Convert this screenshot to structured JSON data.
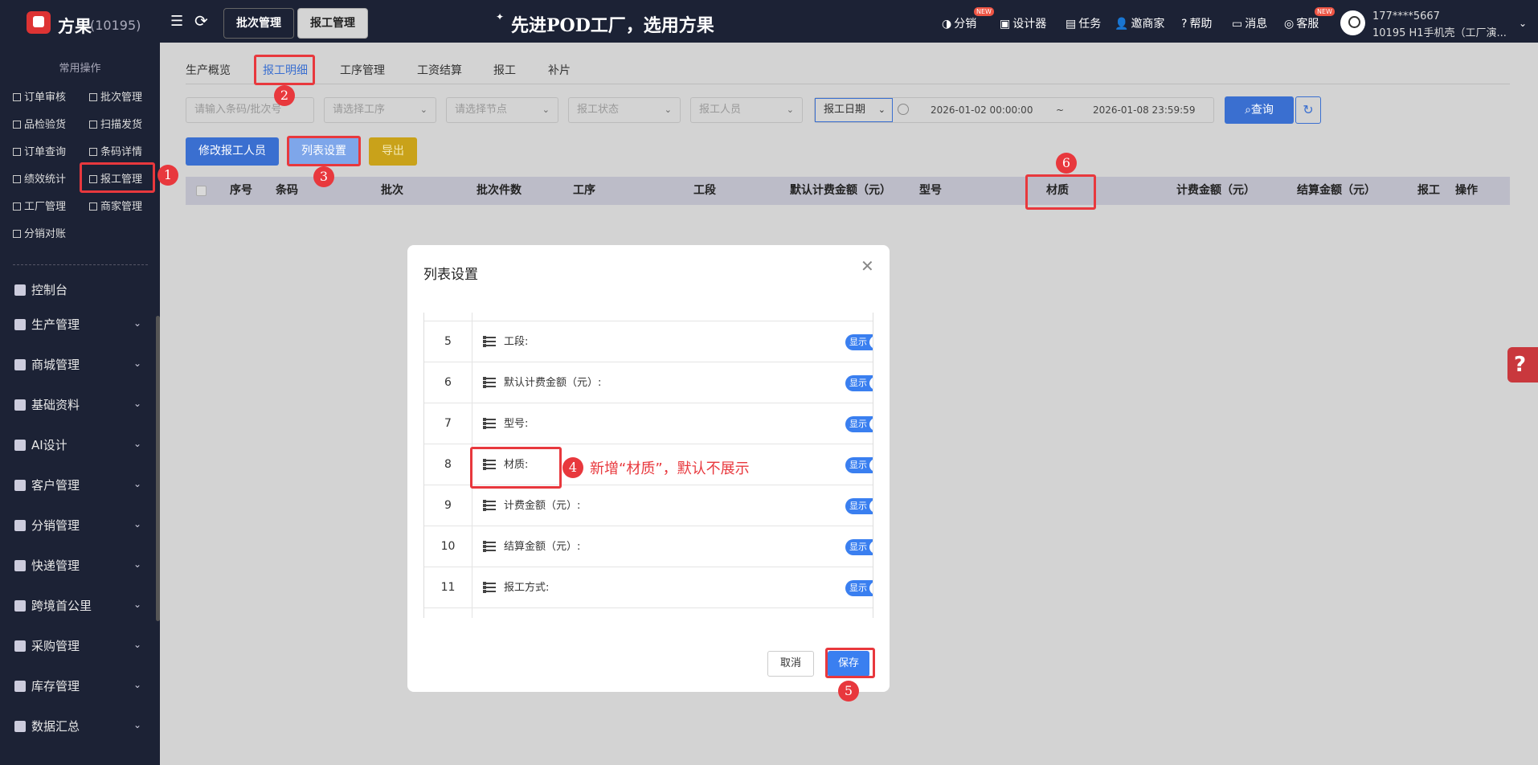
{
  "header": {
    "brand": "方果",
    "brand_id": "(10195)",
    "top_tabs": [
      "批次管理",
      "报工管理"
    ],
    "slogan": "先进POD工厂，选用方果",
    "actions": [
      {
        "label": "分销",
        "badge": "NEW"
      },
      {
        "label": "设计器"
      },
      {
        "label": "任务"
      },
      {
        "label": "邀商家"
      },
      {
        "label": "帮助"
      },
      {
        "label": "消息"
      },
      {
        "label": "客服",
        "badge": "NEW"
      }
    ],
    "user_phone": "177****5667",
    "user_org": "10195  H1手机壳（工厂演..."
  },
  "sidebar": {
    "section_title": "常用操作",
    "quick_links": [
      "订单审核",
      "批次管理",
      "品检验货",
      "扫描发货",
      "订单查询",
      "条码详情",
      "绩效统计",
      "报工管理",
      "工厂管理",
      "商家管理",
      "分销对账"
    ],
    "nav_items": [
      "控制台",
      "生产管理",
      "商城管理",
      "基础资料",
      "AI设计",
      "客户管理",
      "分销管理",
      "快递管理",
      "跨境首公里",
      "采购管理",
      "库存管理",
      "数据汇总"
    ]
  },
  "main": {
    "subtabs": [
      "生产概览",
      "报工明细",
      "工序管理",
      "工资结算",
      "报工",
      "补片"
    ],
    "filters": {
      "barcode_placeholder": "请输入条码/批次号",
      "process_placeholder": "请选择工序",
      "node_placeholder": "请选择节点",
      "status_placeholder": "报工状态",
      "worker_placeholder": "报工人员",
      "date_type": "报工日期",
      "date_start": "2026-01-02 00:00:00",
      "date_sep": "~",
      "date_end": "2026-01-08 23:59:59"
    },
    "query_label": "查询",
    "buttons": {
      "modify": "修改报工人员",
      "list_settings": "列表设置",
      "export": "导出"
    },
    "columns": [
      "序号",
      "条码",
      "批次",
      "批次件数",
      "工序",
      "工段",
      "默认计费金额（元）",
      "型号",
      "材质",
      "计费金额（元）",
      "结算金额（元）",
      "报工",
      "操作"
    ]
  },
  "modal": {
    "title": "列表设置",
    "rows": [
      {
        "num": "5",
        "label": "工段:",
        "toggle": "显示"
      },
      {
        "num": "6",
        "label": "默认计费金额（元）:",
        "toggle": "显示"
      },
      {
        "num": "7",
        "label": "型号:",
        "toggle": "显示"
      },
      {
        "num": "8",
        "label": "材质:",
        "toggle": "显示"
      },
      {
        "num": "9",
        "label": "计费金额（元）:",
        "toggle": "显示"
      },
      {
        "num": "10",
        "label": "结算金额（元）:",
        "toggle": "显示"
      },
      {
        "num": "11",
        "label": "报工方式:",
        "toggle": "显示"
      }
    ],
    "cancel": "取消",
    "save": "保存"
  },
  "annotations": {
    "steps": [
      "1",
      "2",
      "3",
      "4",
      "5",
      "6"
    ],
    "note": "新增“材质”，默认不展示",
    "color": "#e8383d"
  }
}
